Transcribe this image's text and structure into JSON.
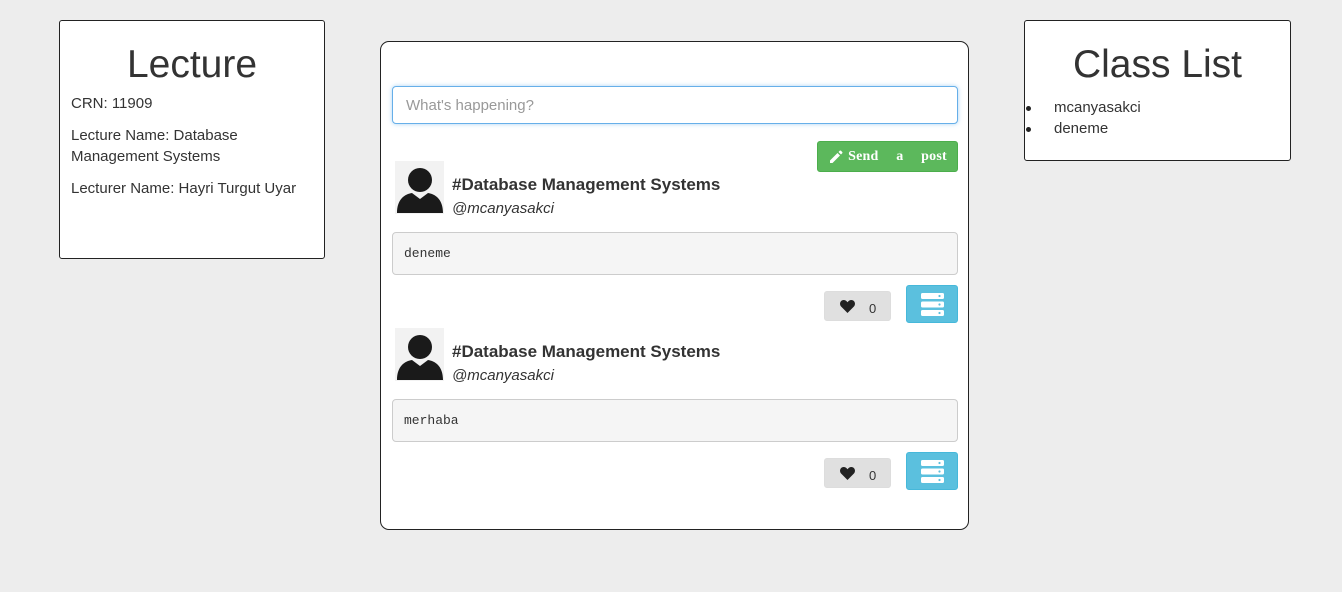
{
  "lecture": {
    "title": "Lecture",
    "crn": "CRN: 11909",
    "lecture_name": "Lecture Name: Database Management Systems",
    "lecturer_name": "Lecturer Name: Hayri Turgut Uyar"
  },
  "feed": {
    "input_placeholder": "What's happening?",
    "send_label": "Send a post",
    "send_icon": "pencil-icon",
    "posts": [
      {
        "title": "#Database Management Systems",
        "user": "@mcanyasakci",
        "body": "deneme",
        "likes": "0"
      },
      {
        "title": "#Database Management Systems",
        "user": "@mcanyasakci",
        "body": "merhaba",
        "likes": "0"
      }
    ]
  },
  "class_list": {
    "title": "Class List",
    "members": [
      "mcanyasakci",
      "deneme"
    ]
  },
  "colors": {
    "background": "#ededed",
    "send_button": "#5cb85c",
    "menu_button": "#5bc0de",
    "like_button": "#e0e0e0",
    "input_focus": "#66afe9"
  }
}
